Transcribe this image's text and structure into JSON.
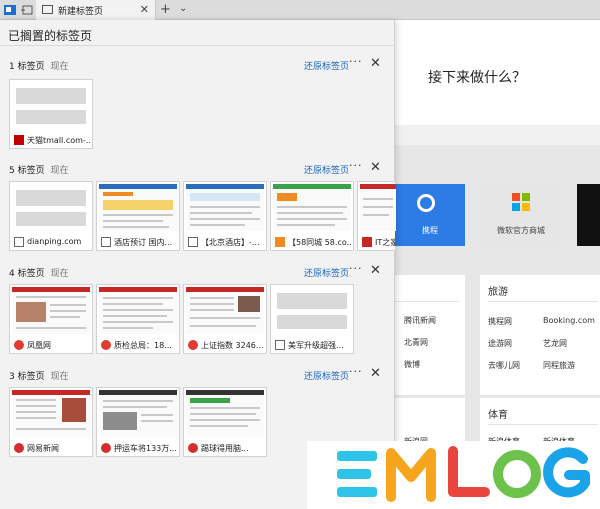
{
  "browser": {
    "active_tab_title": "新建标签页",
    "close_glyph": "✕",
    "new_tab_glyph": "+",
    "dropdown_glyph": "⌄"
  },
  "panel": {
    "title": "已搁置的标签页",
    "restore_label": "还原标签页",
    "more_glyph": "···",
    "close_glyph": "✕",
    "groups": [
      {
        "count_label": "1 标签页",
        "when": "现在",
        "tabs": [
          {
            "caption": "天猫tmall.com-...",
            "favicon": "tmall-icon",
            "favicon_color": "#c40000"
          }
        ]
      },
      {
        "count_label": "5 标签页",
        "when": "现在",
        "tabs": [
          {
            "caption": "dianping.com",
            "favicon": "page-icon"
          },
          {
            "caption": "酒店预订 国内...",
            "favicon": "page-icon"
          },
          {
            "caption": "【北京酒店】-...",
            "favicon": "page-icon"
          },
          {
            "caption": "【58同城 58.co...",
            "favicon": "58-icon"
          },
          {
            "caption": "IT之家",
            "favicon": "ithome-icon"
          }
        ]
      },
      {
        "count_label": "4 标签页",
        "when": "现在",
        "tabs": [
          {
            "caption": "凤凰网",
            "favicon": "ifeng-icon"
          },
          {
            "caption": "质检总局：18...",
            "favicon": "ifeng-icon"
          },
          {
            "caption": "上证指数 3246...",
            "favicon": "ifeng-icon"
          },
          {
            "caption": "美军升级超强...",
            "favicon": "page-icon"
          }
        ]
      },
      {
        "count_label": "3 标签页",
        "when": "现在",
        "tabs": [
          {
            "caption": "网易新闻",
            "favicon": "netease-icon"
          },
          {
            "caption": "押运车将133万...",
            "favicon": "netease-icon"
          },
          {
            "caption": "踢球得用脑...",
            "favicon": "netease-icon"
          }
        ]
      }
    ]
  },
  "new_tab_page": {
    "question": "接下来做什么？",
    "tiles": [
      {
        "label": "携程",
        "color": "#2d7be5"
      },
      {
        "label": "微软官方商城",
        "color": "#e6e6e6"
      }
    ],
    "cards": [
      {
        "heading": "旅游",
        "rows": [
          [
            "携程网",
            "Booking.com"
          ],
          [
            "途游网",
            "艺龙网"
          ],
          [
            "去哪儿网",
            "同程旅游"
          ]
        ]
      },
      {
        "heading": "体育",
        "rows": [
          [
            "新浪体育",
            "新浪体育"
          ]
        ]
      }
    ],
    "news_rows": [
      "腾讯新闻",
      "北青网",
      "微博",
      "新浪网"
    ]
  },
  "watermark": {
    "text": "EMLOG",
    "colors": [
      "#2ec4e8",
      "#f7a51c",
      "#e8453c",
      "#6cc24a",
      "#1aa3e8"
    ]
  }
}
